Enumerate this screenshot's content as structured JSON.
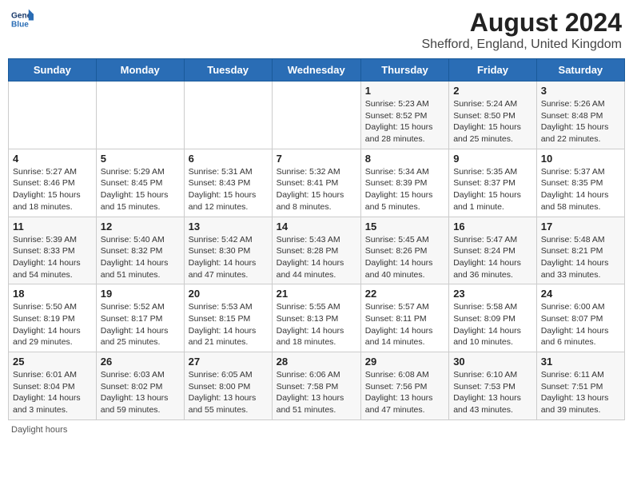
{
  "header": {
    "logo_general": "General",
    "logo_blue": "Blue",
    "main_title": "August 2024",
    "subtitle": "Shefford, England, United Kingdom"
  },
  "calendar": {
    "days_of_week": [
      "Sunday",
      "Monday",
      "Tuesday",
      "Wednesday",
      "Thursday",
      "Friday",
      "Saturday"
    ],
    "weeks": [
      [
        {
          "day": "",
          "info": ""
        },
        {
          "day": "",
          "info": ""
        },
        {
          "day": "",
          "info": ""
        },
        {
          "day": "",
          "info": ""
        },
        {
          "day": "1",
          "info": "Sunrise: 5:23 AM\nSunset: 8:52 PM\nDaylight: 15 hours\nand 28 minutes."
        },
        {
          "day": "2",
          "info": "Sunrise: 5:24 AM\nSunset: 8:50 PM\nDaylight: 15 hours\nand 25 minutes."
        },
        {
          "day": "3",
          "info": "Sunrise: 5:26 AM\nSunset: 8:48 PM\nDaylight: 15 hours\nand 22 minutes."
        }
      ],
      [
        {
          "day": "4",
          "info": "Sunrise: 5:27 AM\nSunset: 8:46 PM\nDaylight: 15 hours\nand 18 minutes."
        },
        {
          "day": "5",
          "info": "Sunrise: 5:29 AM\nSunset: 8:45 PM\nDaylight: 15 hours\nand 15 minutes."
        },
        {
          "day": "6",
          "info": "Sunrise: 5:31 AM\nSunset: 8:43 PM\nDaylight: 15 hours\nand 12 minutes."
        },
        {
          "day": "7",
          "info": "Sunrise: 5:32 AM\nSunset: 8:41 PM\nDaylight: 15 hours\nand 8 minutes."
        },
        {
          "day": "8",
          "info": "Sunrise: 5:34 AM\nSunset: 8:39 PM\nDaylight: 15 hours\nand 5 minutes."
        },
        {
          "day": "9",
          "info": "Sunrise: 5:35 AM\nSunset: 8:37 PM\nDaylight: 15 hours\nand 1 minute."
        },
        {
          "day": "10",
          "info": "Sunrise: 5:37 AM\nSunset: 8:35 PM\nDaylight: 14 hours\nand 58 minutes."
        }
      ],
      [
        {
          "day": "11",
          "info": "Sunrise: 5:39 AM\nSunset: 8:33 PM\nDaylight: 14 hours\nand 54 minutes."
        },
        {
          "day": "12",
          "info": "Sunrise: 5:40 AM\nSunset: 8:32 PM\nDaylight: 14 hours\nand 51 minutes."
        },
        {
          "day": "13",
          "info": "Sunrise: 5:42 AM\nSunset: 8:30 PM\nDaylight: 14 hours\nand 47 minutes."
        },
        {
          "day": "14",
          "info": "Sunrise: 5:43 AM\nSunset: 8:28 PM\nDaylight: 14 hours\nand 44 minutes."
        },
        {
          "day": "15",
          "info": "Sunrise: 5:45 AM\nSunset: 8:26 PM\nDaylight: 14 hours\nand 40 minutes."
        },
        {
          "day": "16",
          "info": "Sunrise: 5:47 AM\nSunset: 8:24 PM\nDaylight: 14 hours\nand 36 minutes."
        },
        {
          "day": "17",
          "info": "Sunrise: 5:48 AM\nSunset: 8:21 PM\nDaylight: 14 hours\nand 33 minutes."
        }
      ],
      [
        {
          "day": "18",
          "info": "Sunrise: 5:50 AM\nSunset: 8:19 PM\nDaylight: 14 hours\nand 29 minutes."
        },
        {
          "day": "19",
          "info": "Sunrise: 5:52 AM\nSunset: 8:17 PM\nDaylight: 14 hours\nand 25 minutes."
        },
        {
          "day": "20",
          "info": "Sunrise: 5:53 AM\nSunset: 8:15 PM\nDaylight: 14 hours\nand 21 minutes."
        },
        {
          "day": "21",
          "info": "Sunrise: 5:55 AM\nSunset: 8:13 PM\nDaylight: 14 hours\nand 18 minutes."
        },
        {
          "day": "22",
          "info": "Sunrise: 5:57 AM\nSunset: 8:11 PM\nDaylight: 14 hours\nand 14 minutes."
        },
        {
          "day": "23",
          "info": "Sunrise: 5:58 AM\nSunset: 8:09 PM\nDaylight: 14 hours\nand 10 minutes."
        },
        {
          "day": "24",
          "info": "Sunrise: 6:00 AM\nSunset: 8:07 PM\nDaylight: 14 hours\nand 6 minutes."
        }
      ],
      [
        {
          "day": "25",
          "info": "Sunrise: 6:01 AM\nSunset: 8:04 PM\nDaylight: 14 hours\nand 3 minutes."
        },
        {
          "day": "26",
          "info": "Sunrise: 6:03 AM\nSunset: 8:02 PM\nDaylight: 13 hours\nand 59 minutes."
        },
        {
          "day": "27",
          "info": "Sunrise: 6:05 AM\nSunset: 8:00 PM\nDaylight: 13 hours\nand 55 minutes."
        },
        {
          "day": "28",
          "info": "Sunrise: 6:06 AM\nSunset: 7:58 PM\nDaylight: 13 hours\nand 51 minutes."
        },
        {
          "day": "29",
          "info": "Sunrise: 6:08 AM\nSunset: 7:56 PM\nDaylight: 13 hours\nand 47 minutes."
        },
        {
          "day": "30",
          "info": "Sunrise: 6:10 AM\nSunset: 7:53 PM\nDaylight: 13 hours\nand 43 minutes."
        },
        {
          "day": "31",
          "info": "Sunrise: 6:11 AM\nSunset: 7:51 PM\nDaylight: 13 hours\nand 39 minutes."
        }
      ]
    ]
  },
  "footer": {
    "note": "Daylight hours"
  }
}
